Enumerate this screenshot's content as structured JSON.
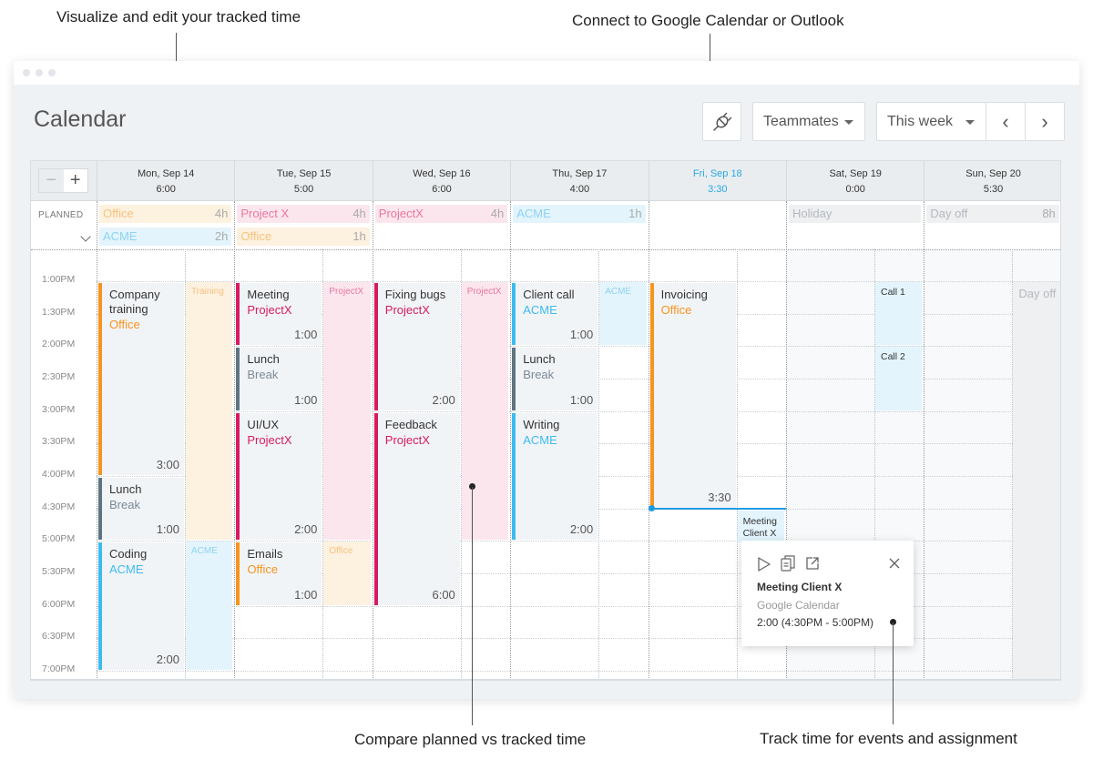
{
  "callouts": {
    "top_left": "Visualize and edit your tracked time",
    "top_right": "Connect to Google Calendar or Outlook",
    "bottom_left": "Compare planned vs tracked time",
    "bottom_right": "Track time for events and assignment"
  },
  "header": {
    "title": "Calendar",
    "connect_icon": "plug-icon",
    "teammates_label": "Teammates",
    "period_label": "This week",
    "prev_label": "‹",
    "next_label": "›"
  },
  "zoom": {
    "minus": "−",
    "plus": "+"
  },
  "planned_label": "PLANNED",
  "days": [
    {
      "label": "Mon, Sep 14",
      "total": "6:00",
      "today": false
    },
    {
      "label": "Tue, Sep 15",
      "total": "5:00",
      "today": false
    },
    {
      "label": "Wed, Sep 16",
      "total": "6:00",
      "today": false
    },
    {
      "label": "Thu, Sep 17",
      "total": "4:00",
      "today": false
    },
    {
      "label": "Fri, Sep 18",
      "total": "3:30",
      "today": true
    },
    {
      "label": "Sat, Sep 19",
      "total": "0:00",
      "today": false
    },
    {
      "label": "Sun, Sep 20",
      "total": "5:30",
      "today": false
    }
  ],
  "planned": [
    {
      "day": 0,
      "row": 0,
      "name": "Office",
      "hours": "4h",
      "kind": "office"
    },
    {
      "day": 0,
      "row": 1,
      "name": "ACME",
      "hours": "2h",
      "kind": "acme"
    },
    {
      "day": 1,
      "row": 0,
      "name": "Project X",
      "hours": "4h",
      "kind": "projectx"
    },
    {
      "day": 1,
      "row": 1,
      "name": "Office",
      "hours": "1h",
      "kind": "office"
    },
    {
      "day": 2,
      "row": 0,
      "name": "ProjectX",
      "hours": "4h",
      "kind": "projectx"
    },
    {
      "day": 3,
      "row": 0,
      "name": "ACME",
      "hours": "1h",
      "kind": "acme"
    },
    {
      "day": 5,
      "row": 0,
      "name": "Holiday",
      "hours": "",
      "kind": "off"
    },
    {
      "day": 6,
      "row": 0,
      "name": "Day off",
      "hours": "8h",
      "kind": "off"
    }
  ],
  "time_labels": [
    "1:00PM",
    "1:30PM",
    "2:00PM",
    "2:30PM",
    "3:00PM",
    "3:30PM",
    "4:00PM",
    "4:30PM",
    "5:00PM",
    "5:30PM",
    "6:00PM",
    "6:30PM",
    "7:00PM"
  ],
  "tracked": [
    {
      "day": 0,
      "start": 0,
      "end": 6,
      "title": "Company training",
      "project": "Office",
      "duration": "3:00",
      "kind": "office"
    },
    {
      "day": 0,
      "start": 6,
      "end": 8,
      "title": "Lunch",
      "project": "Break",
      "duration": "1:00",
      "kind": "break"
    },
    {
      "day": 0,
      "start": 8,
      "end": 12,
      "title": "Coding",
      "project": "ACME",
      "duration": "2:00",
      "kind": "acme"
    },
    {
      "day": 1,
      "start": 0,
      "end": 2,
      "title": "Meeting",
      "project": "ProjectX",
      "duration": "1:00",
      "kind": "projectx"
    },
    {
      "day": 1,
      "start": 2,
      "end": 4,
      "title": "Lunch",
      "project": "Break",
      "duration": "1:00",
      "kind": "break"
    },
    {
      "day": 1,
      "start": 4,
      "end": 8,
      "title": "UI/UX",
      "project": "ProjectX",
      "duration": "2:00",
      "kind": "projectx"
    },
    {
      "day": 1,
      "start": 8,
      "end": 10,
      "title": "Emails",
      "project": "Office",
      "duration": "1:00",
      "kind": "office"
    },
    {
      "day": 2,
      "start": 0,
      "end": 4,
      "title": "Fixing bugs",
      "project": "ProjectX",
      "duration": "2:00",
      "kind": "projectx"
    },
    {
      "day": 2,
      "start": 4,
      "end": 10,
      "title": "Feedback",
      "project": "ProjectX",
      "duration": "6:00",
      "kind": "projectx"
    },
    {
      "day": 3,
      "start": 0,
      "end": 2,
      "title": "Client call",
      "project": "ACME",
      "duration": "1:00",
      "kind": "acme"
    },
    {
      "day": 3,
      "start": 2,
      "end": 4,
      "title": "Lunch",
      "project": "Break",
      "duration": "1:00",
      "kind": "break"
    },
    {
      "day": 3,
      "start": 4,
      "end": 8,
      "title": "Writing",
      "project": "ACME",
      "duration": "2:00",
      "kind": "acme"
    },
    {
      "day": 4,
      "start": 0,
      "end": 7,
      "title": "Invoicing",
      "project": "Office",
      "duration": "3:30",
      "kind": "office"
    }
  ],
  "planned_blocks": [
    {
      "day": 0,
      "start": 0,
      "end": 8,
      "label": "Training",
      "kind": "office"
    },
    {
      "day": 0,
      "start": 8,
      "end": 12,
      "label": "ACME",
      "kind": "acme"
    },
    {
      "day": 1,
      "start": 0,
      "end": 8,
      "label": "ProjectX",
      "kind": "projectx"
    },
    {
      "day": 1,
      "start": 8,
      "end": 10,
      "label": "Office",
      "kind": "office"
    },
    {
      "day": 2,
      "start": 0,
      "end": 8,
      "label": "ProjectX",
      "kind": "projectx"
    },
    {
      "day": 3,
      "start": 0,
      "end": 2,
      "label": "ACME",
      "kind": "acme"
    },
    {
      "day": 5,
      "start": 0,
      "end": 2,
      "label": "Call 1",
      "kind": "event"
    },
    {
      "day": 5,
      "start": 2,
      "end": 4,
      "label": "Call 2",
      "kind": "event"
    },
    {
      "day": 6,
      "start": 0,
      "end": 12.6,
      "label": "Day off",
      "kind": "dayoff"
    }
  ],
  "calendar_event": {
    "day": 4,
    "start": 7,
    "end": 8,
    "label": "Meeting Client X"
  },
  "popup": {
    "title": "Meeting Client X",
    "source": "Google Calendar",
    "time": "2:00 (4:30PM - 5:00PM)"
  },
  "colors": {
    "office": "#f7941d",
    "office_bg": "#fdf1e0",
    "acme": "#3dbbef",
    "acme_bg": "#e3f4fc",
    "projectx": "#d81b60",
    "projectx_bg": "#fbe6ee",
    "break": "#5f7482",
    "off_bg": "#eef0f2",
    "today": "#29a8e0",
    "now_line": "#1e9be0"
  }
}
